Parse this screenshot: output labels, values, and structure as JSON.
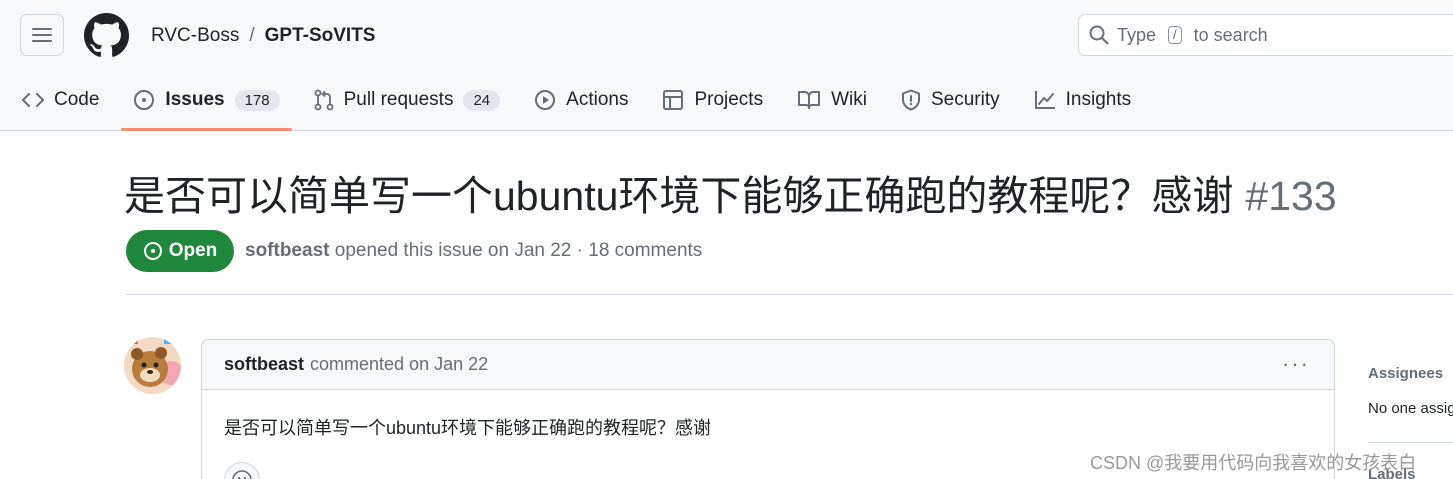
{
  "header": {
    "owner": "RVC-Boss",
    "separator": "/",
    "repo": "GPT-SoVITS",
    "search": {
      "text_before": "Type",
      "kbd": "/",
      "text_after": "to search"
    }
  },
  "tabs": [
    {
      "label": "Code",
      "icon": "code-icon"
    },
    {
      "label": "Issues",
      "icon": "issue-opened-icon",
      "counter": "178",
      "active": true
    },
    {
      "label": "Pull requests",
      "icon": "git-pull-request-icon",
      "counter": "24"
    },
    {
      "label": "Actions",
      "icon": "play-icon"
    },
    {
      "label": "Projects",
      "icon": "table-icon"
    },
    {
      "label": "Wiki",
      "icon": "book-icon"
    },
    {
      "label": "Security",
      "icon": "shield-icon"
    },
    {
      "label": "Insights",
      "icon": "graph-icon"
    }
  ],
  "issue": {
    "title": "是否可以简单写一个ubuntu环境下能够正确跑的教程呢？感谢",
    "number": "#133",
    "state": "Open",
    "author": "softbeast",
    "meta_text": "opened this issue on Jan 22 · 18 comments"
  },
  "comment": {
    "author": "softbeast",
    "header_text": "commented on Jan 22",
    "menu": "···",
    "body": "是否可以简单写一个ubuntu环境下能够正确跑的教程呢？感谢"
  },
  "sidebar": {
    "assignees_label": "Assignees",
    "assignees_value": "No one assigned",
    "labels_label": "Labels"
  },
  "watermark": "CSDN @我要用代码向我喜欢的女孩表白",
  "colors": {
    "open_green": "#1f883d",
    "active_tab_underline": "#fd8c73",
    "header_bg": "#f6f8fa"
  }
}
